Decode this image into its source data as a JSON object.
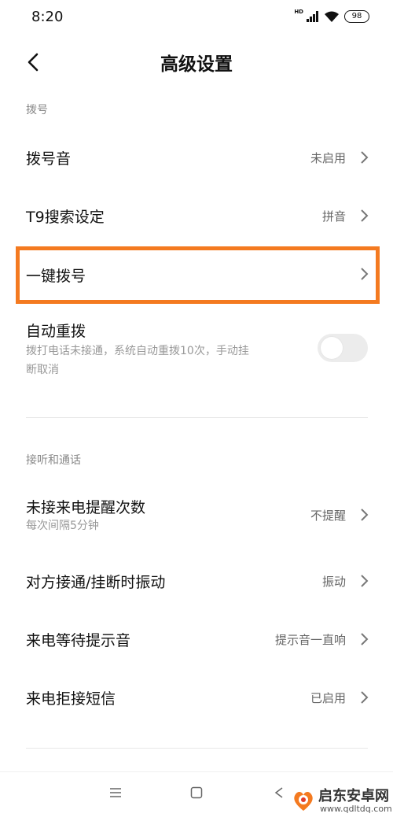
{
  "status_bar": {
    "time": "8:20",
    "network": "HD",
    "battery": "98"
  },
  "header": {
    "title": "高级设置"
  },
  "sections": [
    {
      "title": "拨号",
      "items": [
        {
          "label": "拨号音",
          "value": "未启用"
        },
        {
          "label": "T9搜索设定",
          "value": "拼音"
        },
        {
          "label": "一键拨号",
          "value": ""
        },
        {
          "label": "自动重拨",
          "subtitle_line1": "拨打电话未接通，系统自动重拨10次，手动挂",
          "subtitle_line2": "断取消",
          "toggle_on": false
        }
      ]
    },
    {
      "title": "接听和通话",
      "items": [
        {
          "label": "未接来电提醒次数",
          "subtitle": "每次间隔5分钟",
          "value": "不提醒"
        },
        {
          "label": "对方接通/挂断时振动",
          "value": "振动"
        },
        {
          "label": "来电等待提示音",
          "value": "提示音一直响"
        },
        {
          "label": "来电拒接短信",
          "value": "已启用"
        }
      ]
    }
  ],
  "highlight_color": "#f47a20",
  "navbar": {
    "menu_icon": "menu-icon",
    "home_icon": "home-icon",
    "back_icon": "back-triangle-icon"
  },
  "watermark": {
    "text": "启东安卓网",
    "url": "www.qdltdq.com"
  }
}
